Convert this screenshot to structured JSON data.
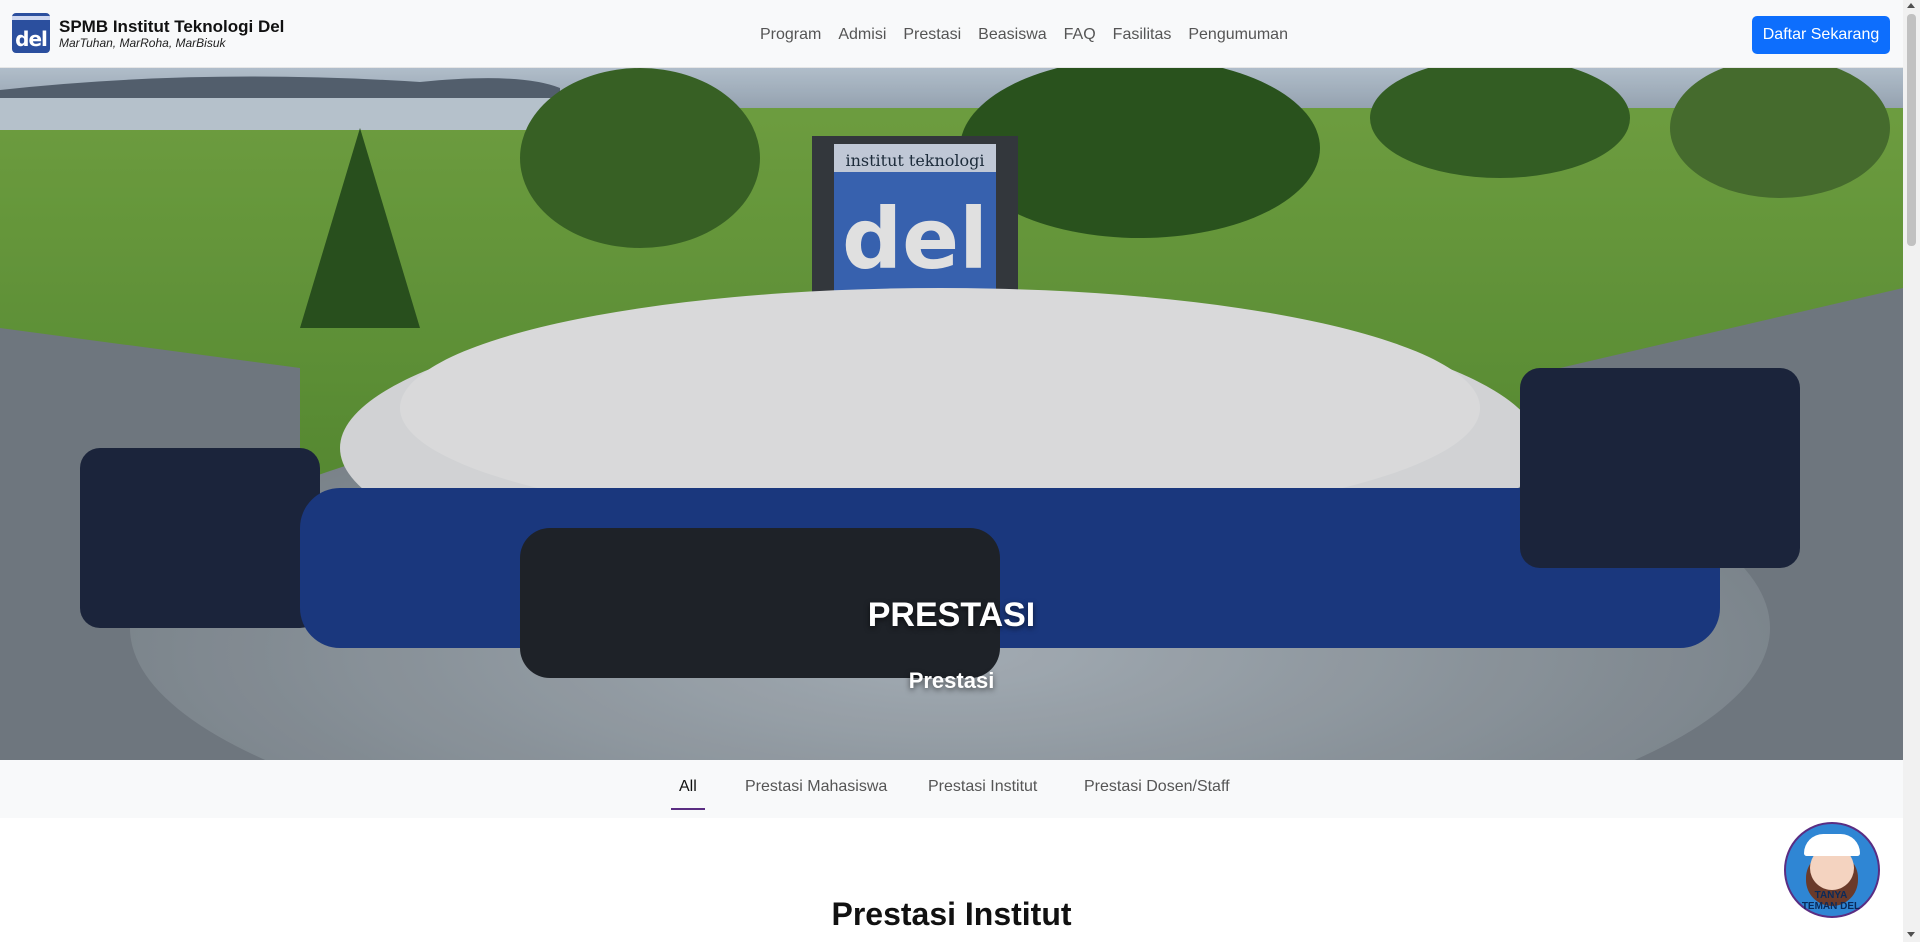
{
  "header": {
    "logo_icon": "del-logo-icon",
    "title": "SPMB Institut Teknologi Del",
    "tagline": "MarTuhan, MarRoha, MarBisuk",
    "nav": [
      "Program",
      "Admisi",
      "Prestasi",
      "Beasiswa",
      "FAQ",
      "Fasilitas",
      "Pengumuman"
    ],
    "cta_label": "Daftar Sekarang",
    "cta_color": "#0d6efd"
  },
  "hero": {
    "title": "PRESTASI",
    "subtitle": "Prestasi"
  },
  "tabs": {
    "items": [
      "All",
      "Prestasi Mahasiswa",
      "Prestasi Institut",
      "Prestasi Dosen/Staff"
    ],
    "active": "All",
    "active_color": "#5a2d82"
  },
  "section": {
    "title": "Prestasi Institut"
  },
  "chat_widget": {
    "icon": "chatbot-avatar-icon",
    "label_line1": "TANYA",
    "label_line2": "TEMAN DEL"
  }
}
